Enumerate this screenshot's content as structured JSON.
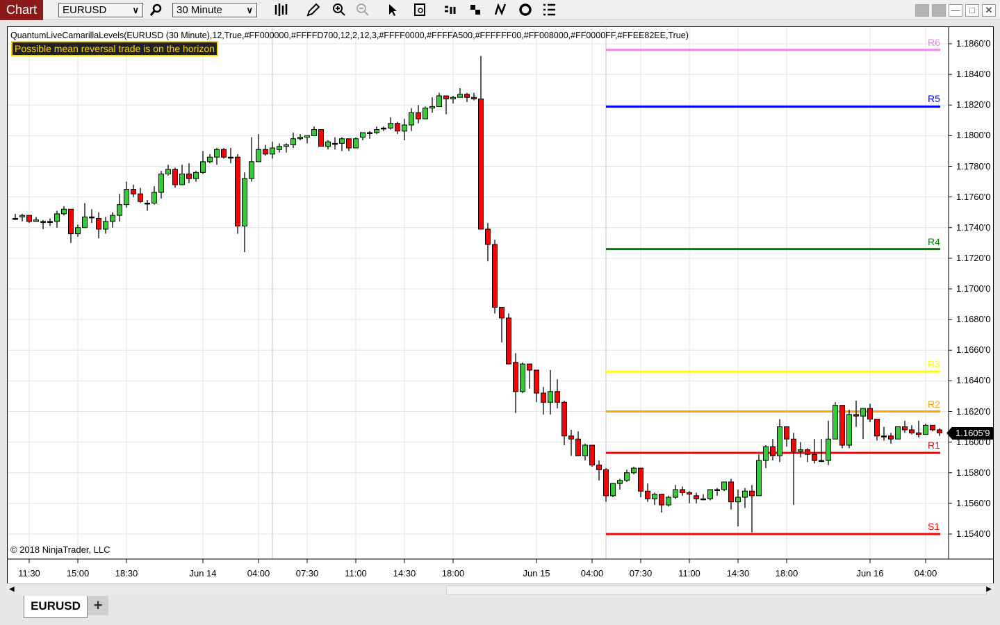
{
  "toolbar": {
    "chart_label": "Chart",
    "instrument": "EURUSD",
    "interval": "30 Minute",
    "icons": [
      "search-icon",
      "bar-type-icon",
      "pencil-icon",
      "zoom-in-icon",
      "zoom-out-icon",
      "pointer-icon",
      "data-box-icon",
      "order-icon",
      "strategy-icon",
      "indicator-icon",
      "reload-icon",
      "list-icon"
    ]
  },
  "window": {
    "buttons": [
      "tile-icon",
      "tile-icon",
      "minimize-icon",
      "maximize-icon",
      "close-icon"
    ]
  },
  "indicator_label": "QuantumLiveCamarillaLevels(EURUSD (30 Minute),12,True,#FF000000,#FFFFD700,12,2,12,3,#FFFF0000,#FFFFA500,#FFFFFF00,#FF008000,#FF0000FF,#FFEE82EE,True)",
  "alert_text": "Possible mean reversal trade is on the horizon",
  "copyright": "© 2018 NinjaTrader, LLC",
  "current_price_label": "1.1605'9",
  "tabs": [
    {
      "label": "EURUSD"
    }
  ],
  "add_tab": "+",
  "colors": {
    "up": "#32cd32",
    "down": "#ff0000",
    "grid": "#e3e3e3"
  },
  "chart_data": {
    "type": "candlestick",
    "instrument": "EURUSD",
    "interval": "30 Minute",
    "ylim": [
      1.153,
      1.187
    ],
    "y_ticks": [
      "1.1860'0",
      "1.1840'0",
      "1.1820'0",
      "1.1800'0",
      "1.1780'0",
      "1.1760'0",
      "1.1740'0",
      "1.1720'0",
      "1.1700'0",
      "1.1680'0",
      "1.1660'0",
      "1.1640'0",
      "1.1620'0",
      "1.1600'0",
      "1.1580'0",
      "1.1560'0",
      "1.1540'0"
    ],
    "y_tick_values": [
      1.186,
      1.184,
      1.182,
      1.18,
      1.178,
      1.176,
      1.174,
      1.172,
      1.17,
      1.168,
      1.166,
      1.164,
      1.162,
      1.16,
      1.158,
      1.156,
      1.154
    ],
    "x_ticks": [
      {
        "label": "11:30",
        "bar": 2
      },
      {
        "label": "15:00",
        "bar": 9
      },
      {
        "label": "18:30",
        "bar": 16
      },
      {
        "label": "Jun 14",
        "bar": 27
      },
      {
        "label": "04:00",
        "bar": 35
      },
      {
        "label": "07:30",
        "bar": 42
      },
      {
        "label": "11:00",
        "bar": 49
      },
      {
        "label": "14:30",
        "bar": 56
      },
      {
        "label": "18:00",
        "bar": 63
      },
      {
        "label": "Jun 15",
        "bar": 75
      },
      {
        "label": "04:00",
        "bar": 83
      },
      {
        "label": "07:30",
        "bar": 90
      },
      {
        "label": "11:00",
        "bar": 97
      },
      {
        "label": "14:30",
        "bar": 104
      },
      {
        "label": "18:00",
        "bar": 111
      },
      {
        "label": "Jun 16",
        "bar": 123
      },
      {
        "label": "04:00",
        "bar": 131
      }
    ],
    "levels_start_bar": 85,
    "levels": [
      {
        "name": "R6",
        "value": 1.1856,
        "color": "#EE82EE"
      },
      {
        "name": "R5",
        "value": 1.1819,
        "color": "#0000FF"
      },
      {
        "name": "R4",
        "value": 1.1726,
        "color": "#008000"
      },
      {
        "name": "R3",
        "value": 1.1646,
        "color": "#FFFF00"
      },
      {
        "name": "R2",
        "value": 1.162,
        "color": "#FFA500"
      },
      {
        "name": "R1",
        "value": 1.1593,
        "color": "#FF0000"
      },
      {
        "name": "S1",
        "value": 1.154,
        "color": "#FF0000"
      }
    ],
    "current_price": 1.16059,
    "ohlc": [
      [
        1.1746,
        1.1749,
        1.1745,
        1.1746
      ],
      [
        1.1747,
        1.1749,
        1.1744,
        1.1748
      ],
      [
        1.1748,
        1.1748,
        1.1743,
        1.1744
      ],
      [
        1.1744,
        1.1747,
        1.1744,
        1.1745
      ],
      [
        1.1744,
        1.1745,
        1.1739,
        1.1744
      ],
      [
        1.1744,
        1.1746,
        1.1741,
        1.1744
      ],
      [
        1.1744,
        1.1751,
        1.174,
        1.1749
      ],
      [
        1.1749,
        1.1754,
        1.1748,
        1.1752
      ],
      [
        1.1752,
        1.1752,
        1.173,
        1.1736
      ],
      [
        1.1736,
        1.1742,
        1.1734,
        1.174
      ],
      [
        1.174,
        1.1756,
        1.174,
        1.1747
      ],
      [
        1.1747,
        1.1752,
        1.1743,
        1.1747
      ],
      [
        1.1746,
        1.175,
        1.1733,
        1.1739
      ],
      [
        1.1739,
        1.1747,
        1.1736,
        1.1744
      ],
      [
        1.1744,
        1.175,
        1.174,
        1.1748
      ],
      [
        1.1748,
        1.1762,
        1.1744,
        1.1755
      ],
      [
        1.1755,
        1.177,
        1.1753,
        1.1765
      ],
      [
        1.1765,
        1.1768,
        1.176,
        1.1762
      ],
      [
        1.1762,
        1.1766,
        1.1756,
        1.1757
      ],
      [
        1.1756,
        1.1758,
        1.1751,
        1.1756
      ],
      [
        1.1756,
        1.1767,
        1.1755,
        1.1763
      ],
      [
        1.1763,
        1.1777,
        1.1759,
        1.1775
      ],
      [
        1.1775,
        1.1781,
        1.1774,
        1.1778
      ],
      [
        1.1778,
        1.1779,
        1.1766,
        1.1768
      ],
      [
        1.1768,
        1.1781,
        1.1768,
        1.1775
      ],
      [
        1.1775,
        1.1782,
        1.1769,
        1.1772
      ],
      [
        1.1772,
        1.1777,
        1.177,
        1.1776
      ],
      [
        1.1776,
        1.179,
        1.1775,
        1.1783
      ],
      [
        1.1783,
        1.1788,
        1.1782,
        1.1786
      ],
      [
        1.1786,
        1.1792,
        1.1781,
        1.1791
      ],
      [
        1.1791,
        1.1792,
        1.1785,
        1.1786
      ],
      [
        1.1786,
        1.1792,
        1.1782,
        1.1786
      ],
      [
        1.1786,
        1.1788,
        1.1736,
        1.1741
      ],
      [
        1.1741,
        1.1776,
        1.1724,
        1.1772
      ],
      [
        1.1772,
        1.1799,
        1.177,
        1.1783
      ],
      [
        1.1783,
        1.1801,
        1.1783,
        1.1791
      ],
      [
        1.1791,
        1.1794,
        1.1787,
        1.1788
      ],
      [
        1.1788,
        1.1796,
        1.1785,
        1.1792
      ],
      [
        1.1791,
        1.1795,
        1.1789,
        1.1793
      ],
      [
        1.1793,
        1.1795,
        1.1789,
        1.1794
      ],
      [
        1.1794,
        1.1802,
        1.1792,
        1.1798
      ],
      [
        1.1798,
        1.1801,
        1.1797,
        1.1799
      ],
      [
        1.1799,
        1.18,
        1.1795,
        1.18
      ],
      [
        1.18,
        1.1806,
        1.18,
        1.1804
      ],
      [
        1.1804,
        1.1804,
        1.1793,
        1.1793
      ],
      [
        1.1793,
        1.1797,
        1.1791,
        1.1796
      ],
      [
        1.1795,
        1.1799,
        1.1791,
        1.1795
      ],
      [
        1.1795,
        1.1799,
        1.179,
        1.1798
      ],
      [
        1.1798,
        1.1798,
        1.179,
        1.1792
      ],
      [
        1.1792,
        1.1799,
        1.1792,
        1.1798
      ],
      [
        1.1799,
        1.1802,
        1.1797,
        1.1802
      ],
      [
        1.1802,
        1.1803,
        1.1798,
        1.1802
      ],
      [
        1.1802,
        1.1806,
        1.1801,
        1.1804
      ],
      [
        1.1805,
        1.1806,
        1.1803,
        1.1805
      ],
      [
        1.1805,
        1.1812,
        1.1804,
        1.1808
      ],
      [
        1.1808,
        1.1809,
        1.1801,
        1.1803
      ],
      [
        1.1803,
        1.1811,
        1.1797,
        1.1807
      ],
      [
        1.1807,
        1.1818,
        1.1803,
        1.1815
      ],
      [
        1.1815,
        1.182,
        1.1808,
        1.1811
      ],
      [
        1.1811,
        1.1819,
        1.1811,
        1.1818
      ],
      [
        1.1818,
        1.1825,
        1.1815,
        1.1819
      ],
      [
        1.1819,
        1.1828,
        1.1819,
        1.1826
      ],
      [
        1.1826,
        1.1826,
        1.1814,
        1.1824
      ],
      [
        1.1824,
        1.1826,
        1.1821,
        1.1825
      ],
      [
        1.1825,
        1.1831,
        1.1825,
        1.1827
      ],
      [
        1.1827,
        1.1828,
        1.1822,
        1.1825
      ],
      [
        1.1825,
        1.1828,
        1.1823,
        1.1824
      ],
      [
        1.1824,
        1.1852,
        1.1739,
        1.1739
      ],
      [
        1.1739,
        1.1743,
        1.1718,
        1.1729
      ],
      [
        1.1729,
        1.1732,
        1.1684,
        1.1688
      ],
      [
        1.1688,
        1.1688,
        1.1665,
        1.1681
      ],
      [
        1.1681,
        1.1684,
        1.1651,
        1.1651
      ],
      [
        1.1652,
        1.1658,
        1.1619,
        1.1633
      ],
      [
        1.1633,
        1.1652,
        1.1632,
        1.1651
      ],
      [
        1.1651,
        1.1651,
        1.1635,
        1.1647
      ],
      [
        1.1647,
        1.1647,
        1.1626,
        1.1632
      ],
      [
        1.1632,
        1.1636,
        1.1618,
        1.1626
      ],
      [
        1.1626,
        1.1647,
        1.1618,
        1.1633
      ],
      [
        1.1633,
        1.1641,
        1.1622,
        1.1626
      ],
      [
        1.1626,
        1.1627,
        1.1598,
        1.1604
      ],
      [
        1.1604,
        1.1608,
        1.1591,
        1.1602
      ],
      [
        1.1602,
        1.1607,
        1.1591,
        1.1591
      ],
      [
        1.1591,
        1.1599,
        1.1588,
        1.1598
      ],
      [
        1.1598,
        1.1598,
        1.1584,
        1.1585
      ],
      [
        1.1585,
        1.1588,
        1.1575,
        1.1582
      ],
      [
        1.1582,
        1.1583,
        1.1561,
        1.1565
      ],
      [
        1.1565,
        1.1573,
        1.1564,
        1.1573
      ],
      [
        1.1573,
        1.1576,
        1.1569,
        1.1575
      ],
      [
        1.1575,
        1.1582,
        1.1574,
        1.158
      ],
      [
        1.158,
        1.1584,
        1.1579,
        1.1583
      ],
      [
        1.1583,
        1.1583,
        1.1564,
        1.1568
      ],
      [
        1.1568,
        1.1573,
        1.1561,
        1.1563
      ],
      [
        1.1563,
        1.1567,
        1.1559,
        1.1566
      ],
      [
        1.1566,
        1.1566,
        1.1554,
        1.1559
      ],
      [
        1.1559,
        1.1565,
        1.1558,
        1.1564
      ],
      [
        1.1564,
        1.1572,
        1.1563,
        1.1569
      ],
      [
        1.1569,
        1.1571,
        1.1565,
        1.1567
      ],
      [
        1.1567,
        1.1568,
        1.156,
        1.1566
      ],
      [
        1.1565,
        1.1567,
        1.156,
        1.1563
      ],
      [
        1.1563,
        1.1566,
        1.1562,
        1.1563
      ],
      [
        1.1563,
        1.1569,
        1.1562,
        1.1569
      ],
      [
        1.1569,
        1.157,
        1.1565,
        1.1569
      ],
      [
        1.1569,
        1.1574,
        1.1568,
        1.1574
      ],
      [
        1.1574,
        1.1576,
        1.1556,
        1.1561
      ],
      [
        1.1561,
        1.1569,
        1.1545,
        1.1564
      ],
      [
        1.1564,
        1.157,
        1.1557,
        1.1568
      ],
      [
        1.1568,
        1.1572,
        1.1541,
        1.1565
      ],
      [
        1.1565,
        1.1592,
        1.1565,
        1.1588
      ],
      [
        1.1588,
        1.1598,
        1.1583,
        1.1597
      ],
      [
        1.1597,
        1.1602,
        1.1588,
        1.1591
      ],
      [
        1.1591,
        1.1615,
        1.1587,
        1.161
      ],
      [
        1.161,
        1.161,
        1.1597,
        1.1602
      ],
      [
        1.1602,
        1.1606,
        1.1559,
        1.1594
      ],
      [
        1.1594,
        1.16,
        1.159,
        1.1595
      ],
      [
        1.1595,
        1.1596,
        1.1587,
        1.1592
      ],
      [
        1.1592,
        1.1602,
        1.1586,
        1.1588
      ],
      [
        1.1588,
        1.1602,
        1.1587,
        1.1588
      ],
      [
        1.1588,
        1.1614,
        1.1585,
        1.1602
      ],
      [
        1.1602,
        1.1626,
        1.1602,
        1.1624
      ],
      [
        1.1624,
        1.1624,
        1.1596,
        1.1598
      ],
      [
        1.1598,
        1.1621,
        1.1596,
        1.1618
      ],
      [
        1.1618,
        1.1627,
        1.161,
        1.1617
      ],
      [
        1.1617,
        1.1622,
        1.1602,
        1.1622
      ],
      [
        1.1622,
        1.1625,
        1.1613,
        1.1615
      ],
      [
        1.1615,
        1.1615,
        1.1601,
        1.1604
      ],
      [
        1.1604,
        1.161,
        1.1601,
        1.1604
      ],
      [
        1.1604,
        1.1606,
        1.1599,
        1.1602
      ],
      [
        1.1602,
        1.161,
        1.1602,
        1.161
      ],
      [
        1.161,
        1.1614,
        1.1606,
        1.1608
      ],
      [
        1.1608,
        1.1611,
        1.1605,
        1.1606
      ],
      [
        1.1606,
        1.1614,
        1.1603,
        1.1605
      ],
      [
        1.1605,
        1.1612,
        1.1605,
        1.1611
      ],
      [
        1.1611,
        1.1611,
        1.1607,
        1.1608
      ],
      [
        1.1608,
        1.1609,
        1.1604,
        1.1606
      ]
    ]
  }
}
